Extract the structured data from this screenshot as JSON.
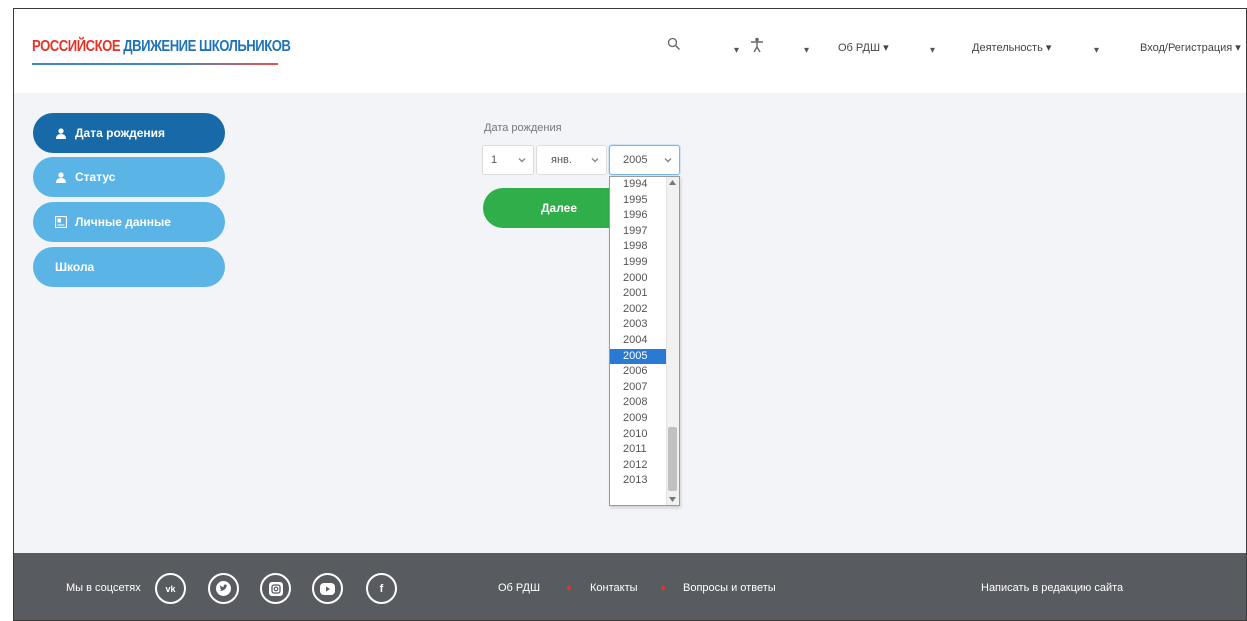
{
  "header": {
    "logo": {
      "part1": "РОССИЙСКОЕ",
      "part2": "ДВИЖЕНИЕ",
      "part3": "ШКОЛЬНИКОВ"
    },
    "nav": {
      "about": "Об РДШ ▾",
      "activity": "Деятельность ▾",
      "login": "Вход/Регистрация ▾"
    },
    "icons": [
      "search-icon",
      "accessibility-icon"
    ]
  },
  "sidebar": {
    "items": [
      {
        "label": "Дата рождения",
        "icon": "user-icon",
        "active": true
      },
      {
        "label": "Статус",
        "icon": "user-icon",
        "active": false
      },
      {
        "label": "Личные данные",
        "icon": "id-card-icon",
        "active": false
      },
      {
        "label": "Школа",
        "icon": "",
        "active": false
      }
    ]
  },
  "form": {
    "label": "Дата рождения",
    "day": "1",
    "month": "янв.",
    "year": "2005",
    "next_label": "Далее",
    "year_options": [
      "1994",
      "1995",
      "1996",
      "1997",
      "1998",
      "1999",
      "2000",
      "2001",
      "2002",
      "2003",
      "2004",
      "2005",
      "2006",
      "2007",
      "2008",
      "2009",
      "2010",
      "2011",
      "2012",
      "2013"
    ],
    "selected_year": "2005"
  },
  "footer": {
    "social_label": "Мы в соцсетях",
    "social": [
      "vk-icon",
      "twitter-icon",
      "instagram-icon",
      "youtube-icon",
      "facebook-icon"
    ],
    "vk_text": "vk",
    "fb_text": "f",
    "links": {
      "about": "Об РДШ",
      "contacts": "Контакты",
      "faq": "Вопросы и ответы",
      "write": "Написать в редакцию сайта"
    }
  },
  "colors": {
    "primary": "#1869a8",
    "sidebar_idle": "#5ab4e6",
    "next_button": "#2fae4a",
    "footer_bg": "#585b60",
    "logo_red": "#e5332a",
    "logo_blue": "#1f74b9",
    "selected_option": "#2a7ad4"
  }
}
